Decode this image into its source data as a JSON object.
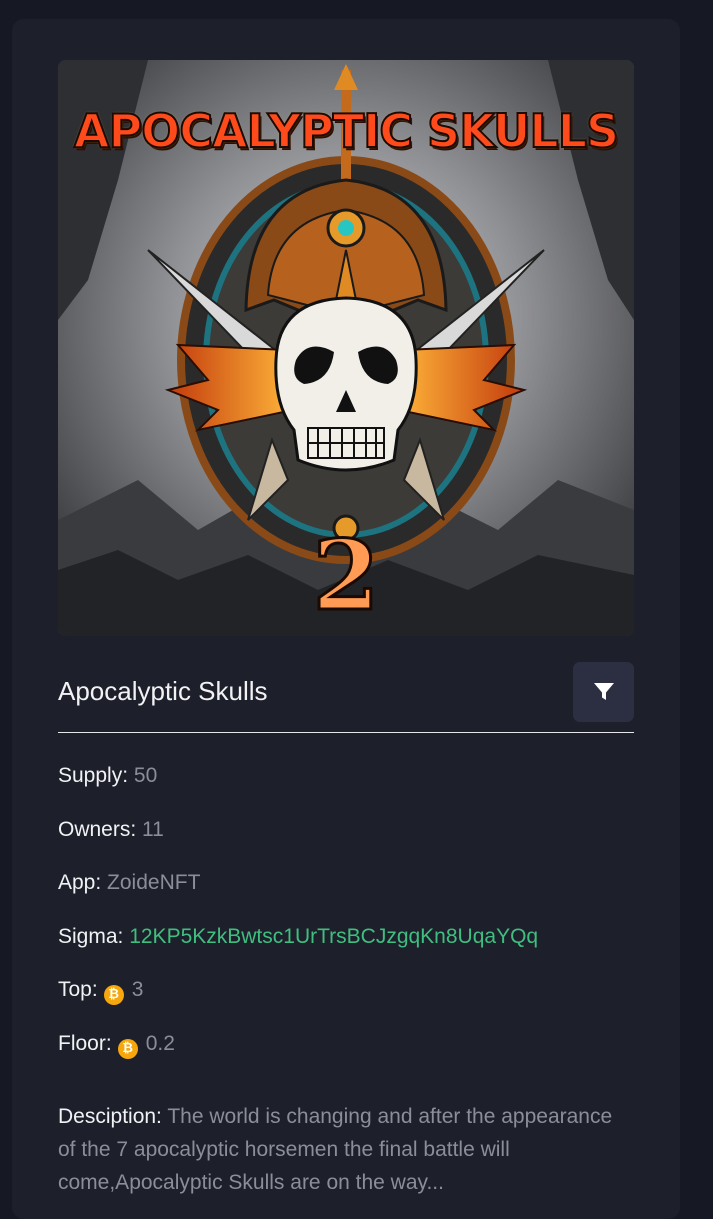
{
  "artwork": {
    "title_text": "APOCALYPTIC SKULLS",
    "number_text": "2"
  },
  "collection": {
    "title": "Apocalyptic Skulls",
    "filter_icon": "filter-icon"
  },
  "details": {
    "supply_label": "Supply:",
    "supply_value": "50",
    "owners_label": "Owners:",
    "owners_value": "11",
    "app_label": "App:",
    "app_value": "ZoideNFT",
    "sigma_label": "Sigma:",
    "sigma_value": "12KP5KzkBwtsc1UrTrsBCJzgqKn8UqaYQq",
    "top_label": "Top:",
    "top_coin": "₿",
    "top_value": "3",
    "floor_label": "Floor:",
    "floor_coin": "₿",
    "floor_value": "0.2",
    "description_label": "Desciption:",
    "description_value": "The world is changing and after the appearance of the 7 apocalyptic horsemen the final battle will come,Apocalyptic Skulls are on the way..."
  },
  "colors": {
    "page_bg": "#161923",
    "card_bg": "#1d202b",
    "sigma_green": "#3fbf7f",
    "coin_orange": "#f5a70d",
    "muted_text": "#8b8e98"
  }
}
